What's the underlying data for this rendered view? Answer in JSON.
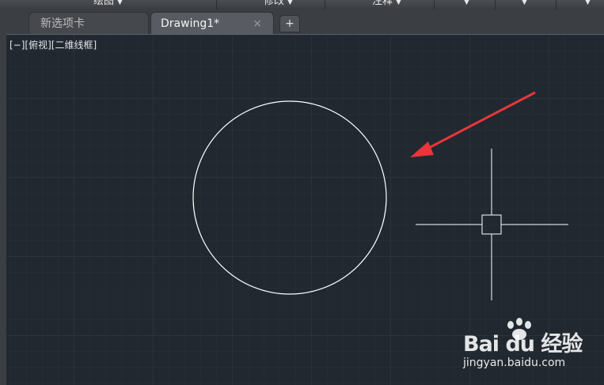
{
  "ribbon": {
    "panels": [
      {
        "label": "绘图"
      },
      {
        "label": "修改"
      },
      {
        "label": "注释"
      }
    ]
  },
  "tabs": [
    {
      "label": "新选项卡",
      "active": false
    },
    {
      "label": "Drawing1*",
      "active": true
    }
  ],
  "tab_close_glyph": "×",
  "tab_add_glyph": "+",
  "viewport": {
    "view_control_label": "[−][俯视][二维线框]",
    "background": "#212830",
    "grid_color": "#2c3440",
    "drawn_objects": [
      "circle"
    ]
  },
  "watermark": {
    "logo_text": "Bai du 经验",
    "url": "jingyan.baidu.com"
  },
  "colors": {
    "entity": "#ffffff",
    "arrow": "#e8363a",
    "crosshair": "#ffffff"
  }
}
